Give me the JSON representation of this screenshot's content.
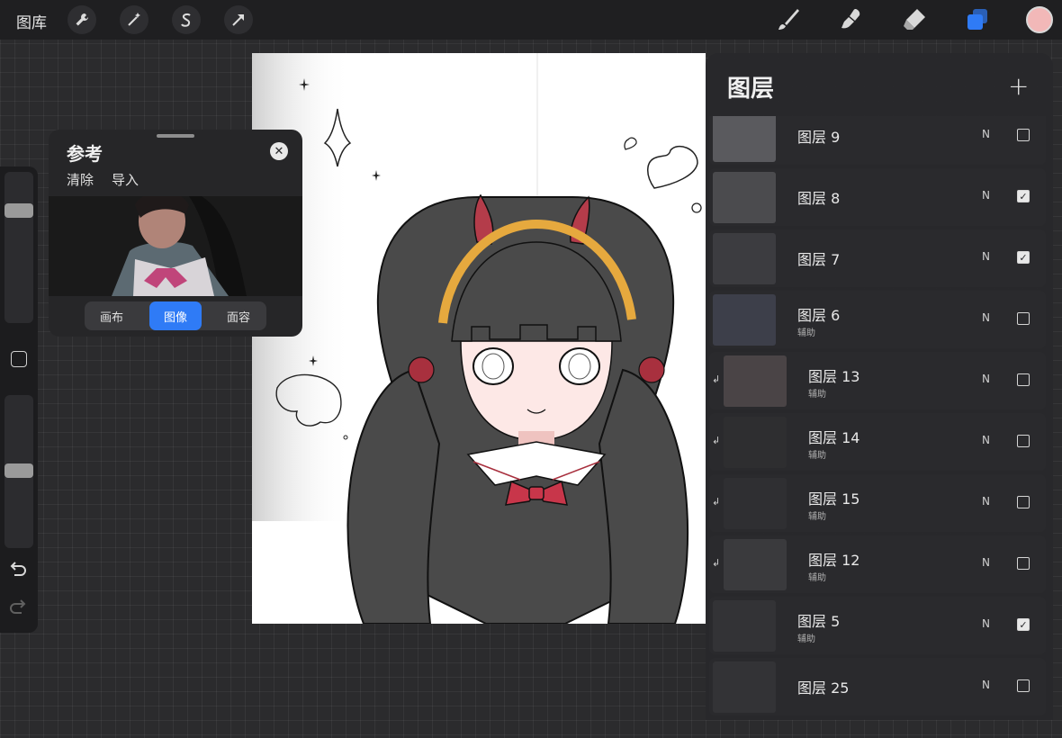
{
  "topbar": {
    "gallery": "图库",
    "tools_left": [
      {
        "name": "wrench-icon",
        "glyph": "🔧"
      },
      {
        "name": "magic-wand-icon",
        "glyph": "✦"
      },
      {
        "name": "selection-icon",
        "glyph": "S"
      },
      {
        "name": "transform-arrow-icon",
        "glyph": "➚"
      }
    ],
    "tools_right": [
      "brush-icon",
      "smudge-icon",
      "eraser-icon",
      "layers-icon"
    ],
    "color": "#f2b8b8",
    "accent": "#2f7bf6"
  },
  "sidebar": {
    "brush_size": 0.21,
    "brush_opacity": 0.54
  },
  "reference": {
    "title": "参考",
    "clear": "清除",
    "import": "导入",
    "close_glyph": "✕",
    "segments": [
      "画布",
      "图像",
      "面容"
    ],
    "active_segment": "图像"
  },
  "layers": {
    "title": "图层",
    "add_glyph": "+",
    "items": [
      {
        "name": "图层 9",
        "sub": "",
        "blend": "N",
        "visible": false,
        "clipped": false
      },
      {
        "name": "图层 8",
        "sub": "",
        "blend": "N",
        "visible": true,
        "clipped": false
      },
      {
        "name": "图层 7",
        "sub": "",
        "blend": "N",
        "visible": true,
        "clipped": false
      },
      {
        "name": "图层 6",
        "sub": "辅助",
        "blend": "N",
        "visible": false,
        "clipped": false
      },
      {
        "name": "图层 13",
        "sub": "辅助",
        "blend": "N",
        "visible": false,
        "clipped": true
      },
      {
        "name": "图层 14",
        "sub": "辅助",
        "blend": "N",
        "visible": false,
        "clipped": true
      },
      {
        "name": "图层 15",
        "sub": "辅助",
        "blend": "N",
        "visible": false,
        "clipped": true
      },
      {
        "name": "图层 12",
        "sub": "辅助",
        "blend": "N",
        "visible": false,
        "clipped": true
      },
      {
        "name": "图层 5",
        "sub": "辅助",
        "blend": "N",
        "visible": true,
        "clipped": false
      },
      {
        "name": "图层 25",
        "sub": "",
        "blend": "N",
        "visible": false,
        "clipped": false
      }
    ]
  }
}
